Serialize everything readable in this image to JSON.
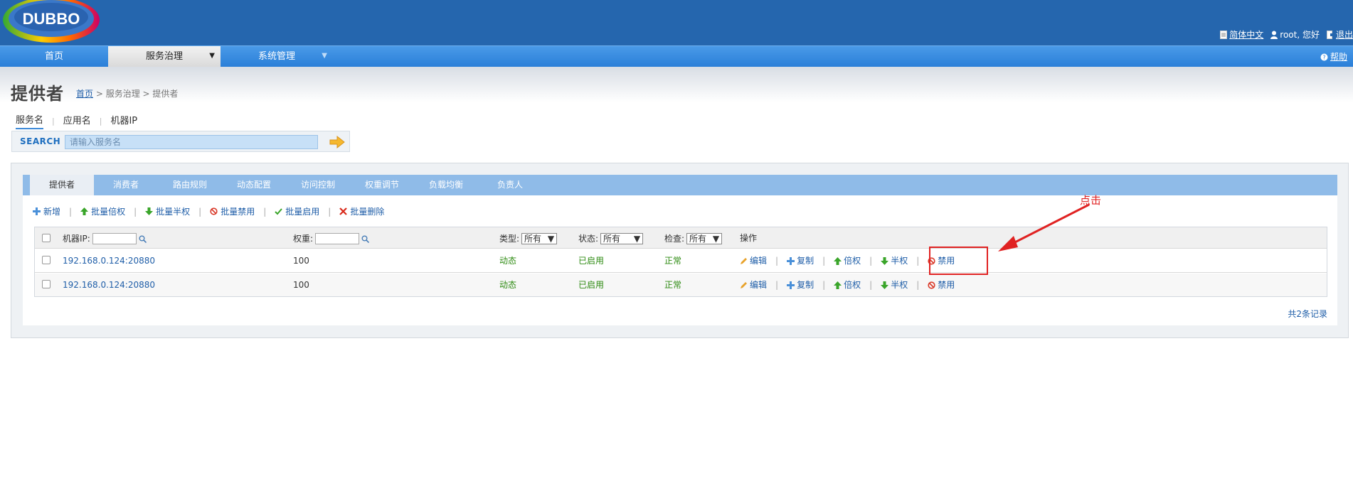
{
  "header": {
    "logo_text": "DUBBO",
    "language_link": "简体中文",
    "user_greeting": "root, 您好",
    "logout_link": "退出"
  },
  "nav": {
    "items": [
      {
        "label": "首页",
        "active": false
      },
      {
        "label": "服务治理",
        "active": true,
        "dropdown_glyph": "▼"
      },
      {
        "label": "系统管理",
        "active": false,
        "dropdown_glyph": "▼"
      }
    ],
    "help_label": "帮助"
  },
  "page": {
    "title": "提供者",
    "breadcrumb": {
      "home": "首页",
      "rest": "> 服务治理 > 提供者"
    }
  },
  "search": {
    "tabs": [
      "服务名",
      "应用名",
      "机器IP"
    ],
    "tab_separator": "|",
    "label": "SEARCH",
    "placeholder": "请输入服务名"
  },
  "tabs": [
    {
      "label": "提供者",
      "active": true
    },
    {
      "label": "消费者",
      "active": false
    },
    {
      "label": "路由规则",
      "active": false
    },
    {
      "label": "动态配置",
      "active": false
    },
    {
      "label": "访问控制",
      "active": false
    },
    {
      "label": "权重调节",
      "active": false
    },
    {
      "label": "负载均衡",
      "active": false
    },
    {
      "label": "负责人",
      "active": false
    }
  ],
  "toolbar": {
    "separator": "|",
    "add": "新增",
    "batch_double": "批量倍权",
    "batch_half": "批量半权",
    "batch_disable": "批量禁用",
    "batch_enable": "批量启用",
    "batch_delete": "批量删除"
  },
  "table": {
    "headers": {
      "ip": "机器IP:",
      "weight": "权重:",
      "type": "类型:",
      "status": "状态:",
      "check": "检查:",
      "operations": "操作"
    },
    "filters": {
      "type_value": "所有",
      "status_value": "所有",
      "check_value": "所有"
    },
    "rows": [
      {
        "ip": "192.168.0.124:20880",
        "weight": "100",
        "type": "动态",
        "status": "已启用",
        "check": "正常"
      },
      {
        "ip": "192.168.0.124:20880",
        "weight": "100",
        "type": "动态",
        "status": "已启用",
        "check": "正常"
      }
    ],
    "ops": {
      "separator": "|",
      "edit": "编辑",
      "copy": "复制",
      "double": "倍权",
      "half": "半权",
      "disable": "禁用"
    },
    "total": "共2条记录"
  },
  "annotation": {
    "text": "点击",
    "color": "#e02222"
  },
  "colors": {
    "header_bg": "#2566ae",
    "nav_bg": "#2a7fd8",
    "tabbar_bg": "#8fbbe8",
    "link": "#1f5ea8",
    "status_green": "#2e8b12"
  }
}
